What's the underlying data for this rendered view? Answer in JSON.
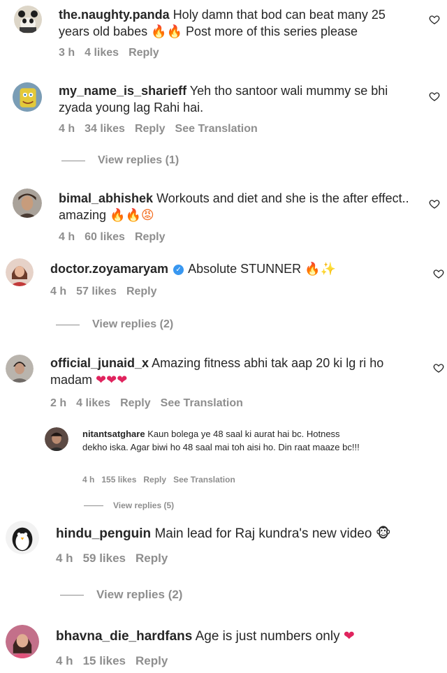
{
  "comments": [
    {
      "username": "the.naughty.panda",
      "text": "Holy damn that bod can beat many 25 years old babes",
      "emoji": "🔥🔥",
      "text_after": " Post more of this series please",
      "time": "3 h",
      "likes": "4 likes",
      "reply": "Reply",
      "avatar_icon": "panda-avatar"
    },
    {
      "username": "my_name_is_sharieff",
      "text": "Yeh tho santoor wali mummy se bhi zyada young lag Rahi hai.",
      "time": "4 h",
      "likes": "34 likes",
      "reply": "Reply",
      "translation": "See Translation",
      "view_replies": "View replies (1)",
      "avatar_icon": "spongebob-avatar"
    },
    {
      "username": "bimal_abhishek",
      "text": "Workouts and diet and she is the after effect.. amazing",
      "emoji": "🔥🔥😡",
      "time": "4 h",
      "likes": "60 likes",
      "reply": "Reply",
      "avatar_icon": "user-avatar"
    },
    {
      "username": "doctor.zoyamaryam",
      "text": "Absolute STUNNER",
      "emoji": "🔥✨",
      "time": "4 h",
      "likes": "57 likes",
      "reply": "Reply",
      "view_replies": "View replies (2)",
      "verified": true,
      "avatar_icon": "user-avatar"
    },
    {
      "username": "official_junaid_x",
      "text": "Amazing fitness abhi tak aap 20 ki lg ri ho madam",
      "emoji": "❤❤❤",
      "time": "2 h",
      "likes": "4 likes",
      "reply": "Reply",
      "translation": "See Translation",
      "avatar_icon": "user-avatar"
    },
    {
      "username": "nitantsatghare",
      "text": "Kaun bolega ye 48 saal ki aurat hai bc. Hotness dekho iska. Agar biwi ho 48 saal mai toh aisi ho. Din raat maaze bc!!!",
      "time": "4 h",
      "likes": "155 likes",
      "reply": "Reply",
      "translation": "See Translation",
      "view_replies": "View replies (5)",
      "avatar_icon": "user-avatar"
    },
    {
      "username": "hindu_penguin",
      "text": "Main lead for Raj kundra's new video",
      "emoji": "🐵",
      "time": "4 h",
      "likes": "59 likes",
      "reply": "Reply",
      "view_replies": "View replies (2)",
      "avatar_icon": "penguin-avatar"
    },
    {
      "username": "bhavna_die_hardfans",
      "text": "Age is just numbers only",
      "emoji": "❤",
      "time": "4 h",
      "likes": "15 likes",
      "reply": "Reply",
      "avatar_icon": "user-avatar"
    }
  ],
  "colors": {
    "text": "#262626",
    "meta": "#8e8e8e",
    "verified": "#3897f0",
    "fire": "#f36b1c",
    "heart": "#e0245e"
  }
}
